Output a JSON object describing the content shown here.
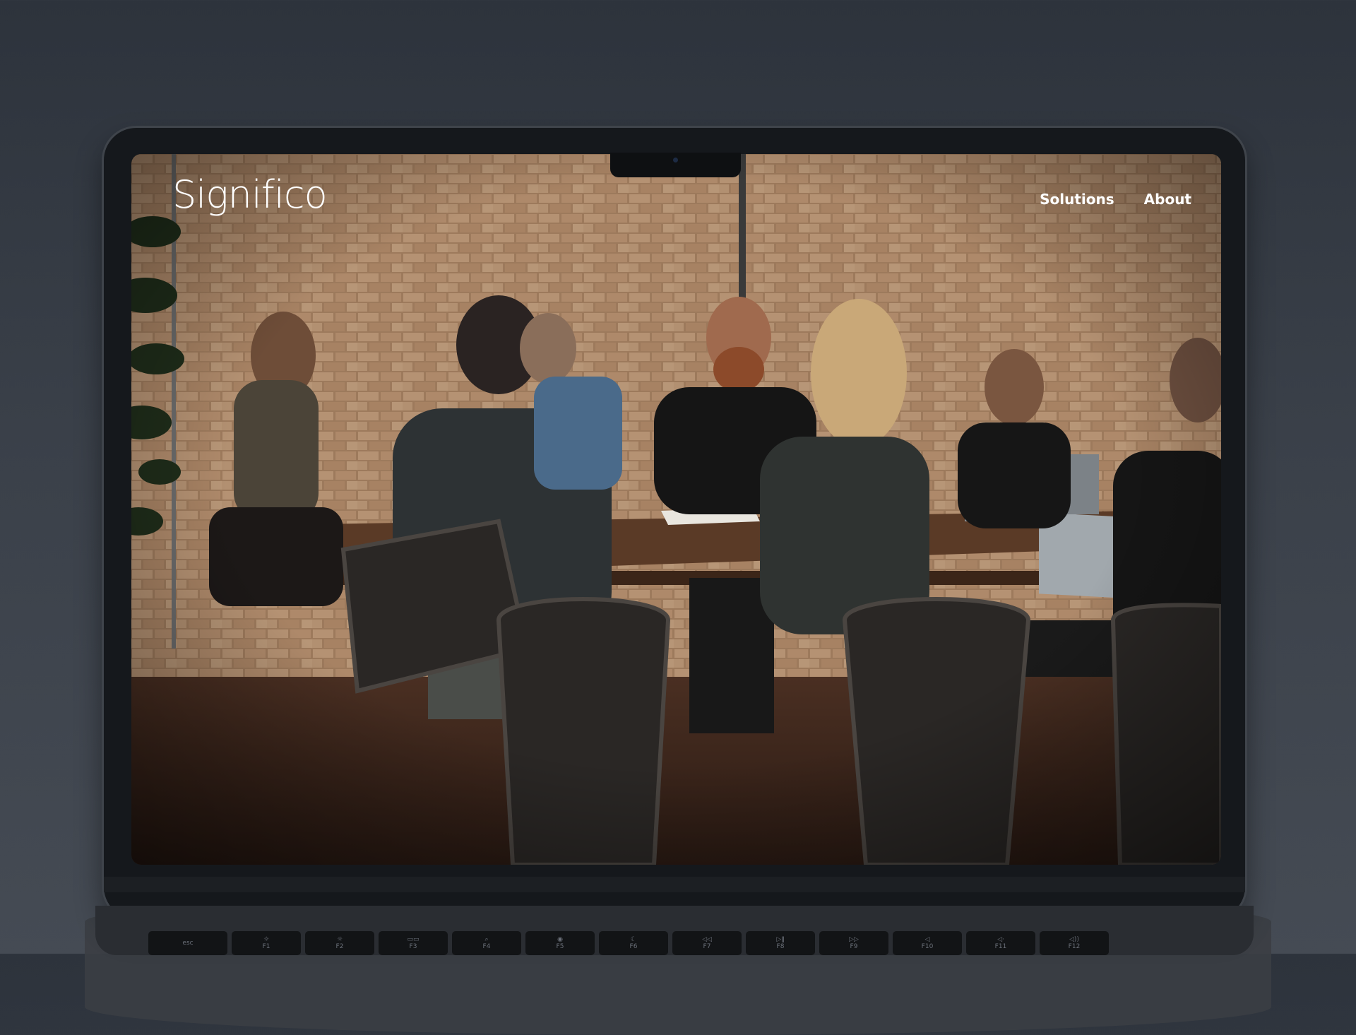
{
  "site": {
    "logo_text": "Significo",
    "nav": [
      {
        "label": "Solutions"
      },
      {
        "label": "About"
      }
    ]
  },
  "hero": {
    "media": "team-meeting-photo"
  },
  "keyboard": {
    "keys": [
      {
        "top": "",
        "bottom": "esc"
      },
      {
        "top": "☼",
        "bottom": "F1"
      },
      {
        "top": "☼",
        "bottom": "F2"
      },
      {
        "top": "▭▭",
        "bottom": "F3"
      },
      {
        "top": "⌕",
        "bottom": "F4"
      },
      {
        "top": "◉",
        "bottom": "F5"
      },
      {
        "top": "☾",
        "bottom": "F6"
      },
      {
        "top": "◁◁",
        "bottom": "F7"
      },
      {
        "top": "▷ǁ",
        "bottom": "F8"
      },
      {
        "top": "▷▷",
        "bottom": "F9"
      },
      {
        "top": "◁",
        "bottom": "F10"
      },
      {
        "top": "◁·",
        "bottom": "F11"
      },
      {
        "top": "◁))",
        "bottom": "F12"
      }
    ]
  },
  "colors": {
    "background_top": "#2d333c",
    "laptop_bezel": "#15181c",
    "brick": "#b08868",
    "table": "#5a3a26"
  }
}
